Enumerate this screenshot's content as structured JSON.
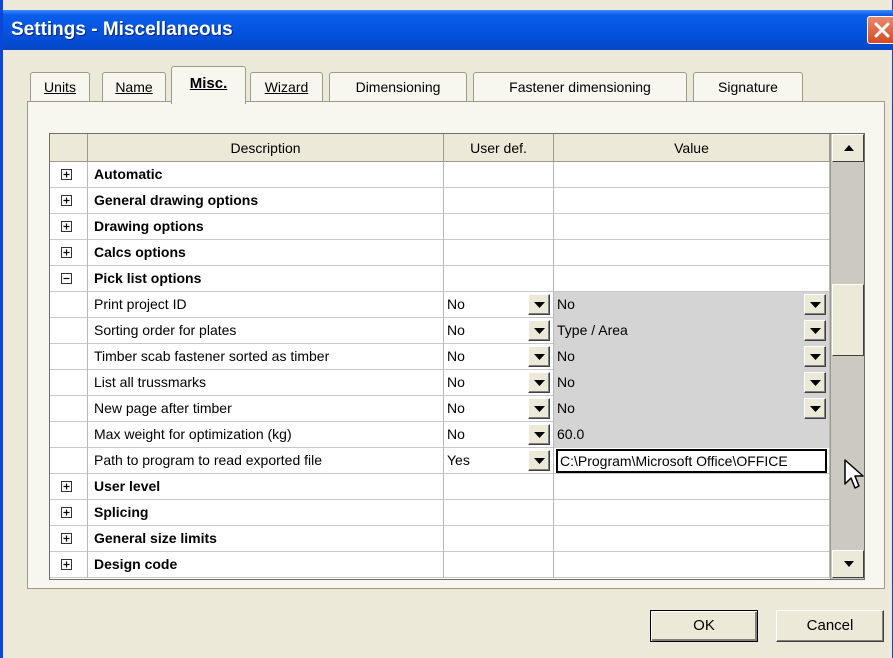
{
  "window": {
    "title": "Settings - Miscellaneous"
  },
  "tabs": [
    {
      "label": "Units",
      "active": false
    },
    {
      "label": "Name",
      "active": false
    },
    {
      "label": "Misc.",
      "active": true
    },
    {
      "label": "Wizard",
      "active": false
    },
    {
      "label": "Dimensioning",
      "active": false
    },
    {
      "label": "Fastener dimensioning",
      "active": false
    },
    {
      "label": "Signature",
      "active": false
    }
  ],
  "grid": {
    "headers": [
      "Description",
      "User def.",
      "Value"
    ],
    "rows": [
      {
        "type": "group",
        "expanded": false,
        "label": "Automatic"
      },
      {
        "type": "group",
        "expanded": false,
        "label": "General drawing options"
      },
      {
        "type": "group",
        "expanded": false,
        "label": "Drawing options"
      },
      {
        "type": "group",
        "expanded": false,
        "label": "Calcs options"
      },
      {
        "type": "group",
        "expanded": true,
        "label": "Pick list options"
      },
      {
        "type": "item",
        "label": "Print project ID",
        "user_def": "No",
        "value": "No",
        "value_combo": true
      },
      {
        "type": "item",
        "label": "Sorting order for plates",
        "user_def": "No",
        "value": "Type / Area",
        "value_combo": true
      },
      {
        "type": "item",
        "label": "Timber scab fastener sorted as timber",
        "user_def": "No",
        "value": "No",
        "value_combo": true
      },
      {
        "type": "item",
        "label": "List all trussmarks",
        "user_def": "No",
        "value": "No",
        "value_combo": true
      },
      {
        "type": "item",
        "label": "New page after timber",
        "user_def": "No",
        "value": "No",
        "value_combo": true
      },
      {
        "type": "item",
        "label": "Max weight for optimization (kg)",
        "user_def": "No",
        "value": "60.0",
        "value_combo": false
      },
      {
        "type": "item",
        "label": "Path to program to read exported file",
        "user_def": "Yes",
        "value": "C:\\Program\\Microsoft Office\\OFFICE",
        "value_combo": false,
        "editing": true
      },
      {
        "type": "group",
        "expanded": false,
        "label": "User level"
      },
      {
        "type": "group",
        "expanded": false,
        "label": "Splicing"
      },
      {
        "type": "group",
        "expanded": false,
        "label": "General size limits"
      },
      {
        "type": "group",
        "expanded": false,
        "label": "Design code"
      }
    ]
  },
  "buttons": {
    "ok": "OK",
    "cancel": "Cancel"
  },
  "colors": {
    "title_bar": "#0453e0",
    "dialog_bg": "#ece9d8",
    "value_disabled_bg": "#d4d4d4"
  }
}
